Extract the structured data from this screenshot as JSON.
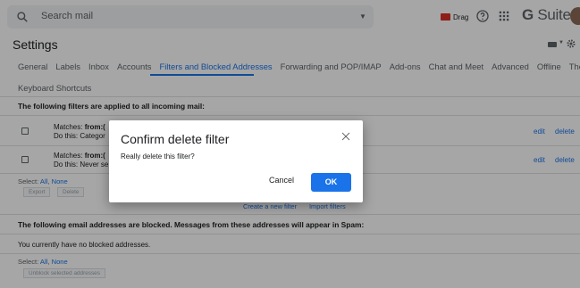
{
  "search": {
    "placeholder": "Search mail"
  },
  "header": {
    "drag_label": "Drag",
    "brand_g": "G",
    "brand_rest": " Suite"
  },
  "settings": {
    "title": "Settings",
    "tabs": [
      {
        "label": "General",
        "active": false
      },
      {
        "label": "Labels",
        "active": false
      },
      {
        "label": "Inbox",
        "active": false
      },
      {
        "label": "Accounts",
        "active": false
      },
      {
        "label": "Filters and Blocked Addresses",
        "active": true
      },
      {
        "label": "Forwarding and POP/IMAP",
        "active": false
      },
      {
        "label": "Add-ons",
        "active": false
      },
      {
        "label": "Chat and Meet",
        "active": false
      },
      {
        "label": "Advanced",
        "active": false
      },
      {
        "label": "Offline",
        "active": false
      },
      {
        "label": "Themes",
        "active": false
      }
    ],
    "tab_row2": "Keyboard Shortcuts"
  },
  "filters": {
    "heading": "The following filters are applied to all incoming mail:",
    "rows": [
      {
        "matches_label": "Matches: ",
        "matches_value": "from:(",
        "do_this": "Do this: Categor",
        "edit": "edit",
        "delete": "delete"
      },
      {
        "matches_label": "Matches: ",
        "matches_value": "from:(",
        "do_this": "Do this: Never se",
        "edit": "edit",
        "delete": "delete"
      }
    ],
    "select_prefix": "Select: ",
    "select_all": "All",
    "select_sep": ", ",
    "select_none": "None",
    "export_button": "Export",
    "delete_button": "Delete",
    "create_filter": "Create a new filter",
    "import_filters": "Import filters"
  },
  "blocked": {
    "heading": "The following email addresses are blocked. Messages from these addresses will appear in Spam:",
    "empty_text": "You currently have no blocked addresses.",
    "select_prefix": "Select: ",
    "select_all": "All",
    "select_sep": ", ",
    "select_none": "None",
    "unblock_button": "Unblock selected addresses"
  },
  "dialog": {
    "title": "Confirm delete filter",
    "message": "Really delete this filter?",
    "cancel_label": "Cancel",
    "ok_label": "OK"
  },
  "colors": {
    "accent": "#1a73e8",
    "drag_red": "#d93025"
  }
}
